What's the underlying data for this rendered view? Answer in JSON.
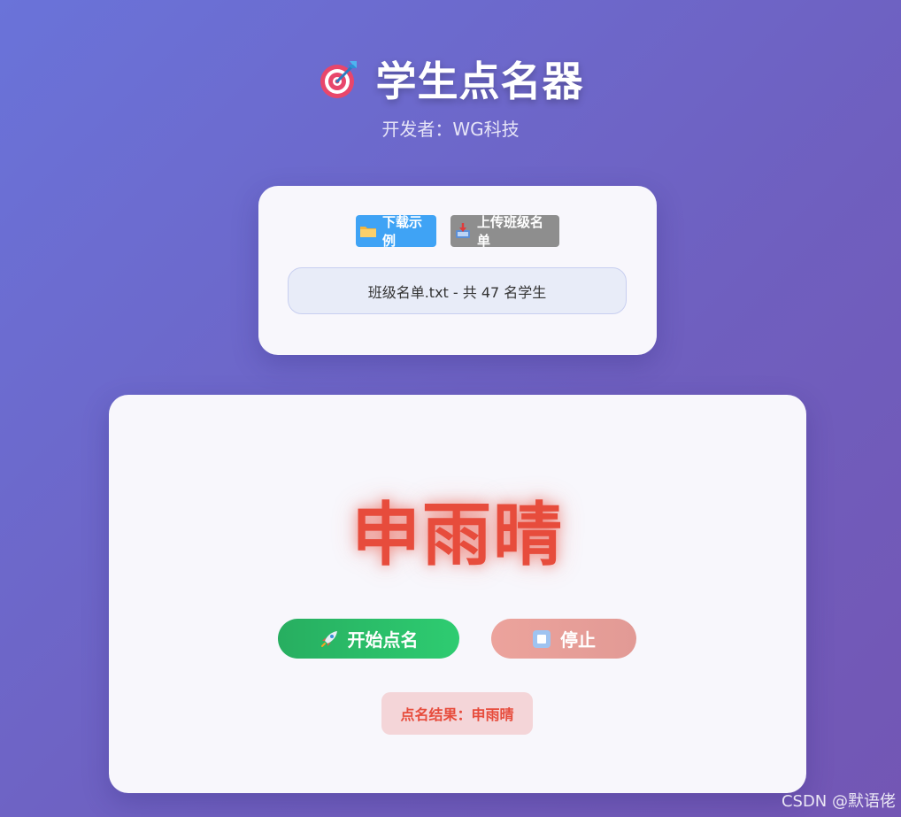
{
  "header": {
    "title": "学生点名器",
    "title_icon": "target-icon",
    "subtitle": "开发者：WG科技"
  },
  "upload_panel": {
    "download_example_label": "下载示例",
    "download_icon": "folder-icon",
    "upload_list_label": "上传班级名单",
    "upload_icon": "inbox-tray-icon",
    "file_status": "班级名单.txt - 共 47 名学生"
  },
  "roll_call": {
    "current_name": "申雨晴",
    "start_label": "开始点名",
    "start_icon": "rocket-icon",
    "stop_label": "停止",
    "stop_icon": "stop-icon",
    "result_text": "点名结果：申雨晴"
  },
  "watermark": "CSDN @默语佬",
  "colors": {
    "accent_red": "#e74c3c",
    "start_green": "#2ecc71",
    "download_blue": "#3fa3f5",
    "upload_gray": "#8e8e8e",
    "stop_pink": "#eca39c"
  }
}
